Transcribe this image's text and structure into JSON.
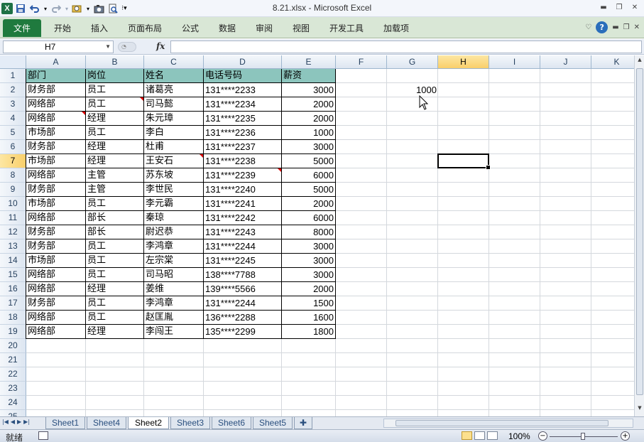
{
  "app": {
    "title": "8.21.xlsx - Microsoft Excel",
    "logo_letter": "X"
  },
  "ribbon": {
    "file_tab": "文件",
    "tabs": [
      "开始",
      "插入",
      "页面布局",
      "公式",
      "数据",
      "审阅",
      "视图",
      "开发工具",
      "加载项"
    ],
    "help_symbol": "?"
  },
  "formula_bar": {
    "name_box": "H7",
    "fx_symbol": "fx",
    "formula": ""
  },
  "columns": [
    "A",
    "B",
    "C",
    "D",
    "E",
    "F",
    "G",
    "H",
    "I",
    "J",
    "K"
  ],
  "selected_column": "H",
  "selected_row": "7",
  "rows": [
    "1",
    "2",
    "3",
    "4",
    "5",
    "6",
    "7",
    "8",
    "9",
    "10",
    "11",
    "12",
    "13",
    "14",
    "15",
    "16",
    "17",
    "18",
    "19",
    "20",
    "21",
    "22",
    "23",
    "24",
    "25"
  ],
  "table": {
    "headers": [
      "部门",
      "岗位",
      "姓名",
      "电话号码",
      "薪资"
    ],
    "records": [
      [
        "财务部",
        "员工",
        "诸葛亮",
        "131****2233",
        "3000"
      ],
      [
        "网络部",
        "员工",
        "司马懿",
        "131****2234",
        "2000"
      ],
      [
        "网络部",
        "经理",
        "朱元璋",
        "131****2235",
        "2000"
      ],
      [
        "市场部",
        "员工",
        "李白",
        "131****2236",
        "1000"
      ],
      [
        "财务部",
        "经理",
        "杜甫",
        "131****2237",
        "3000"
      ],
      [
        "市场部",
        "经理",
        "王安石",
        "131****2238",
        "5000"
      ],
      [
        "网络部",
        "主管",
        "苏东坡",
        "131****2239",
        "6000"
      ],
      [
        "财务部",
        "主管",
        "李世民",
        "131****2240",
        "5000"
      ],
      [
        "市场部",
        "员工",
        "李元霸",
        "131****2241",
        "2000"
      ],
      [
        "网络部",
        "部长",
        "秦琼",
        "131****2242",
        "6000"
      ],
      [
        "财务部",
        "部长",
        "尉迟恭",
        "131****2243",
        "8000"
      ],
      [
        "财务部",
        "员工",
        "李鸿章",
        "131****2244",
        "3000"
      ],
      [
        "市场部",
        "员工",
        "左宗棠",
        "131****2245",
        "3000"
      ],
      [
        "网络部",
        "员工",
        "司马昭",
        "138****7788",
        "3000"
      ],
      [
        "网络部",
        "经理",
        "姜维",
        "139****5566",
        "2000"
      ],
      [
        "财务部",
        "员工",
        "李鸿章",
        "131****2244",
        "1500"
      ],
      [
        "网络部",
        "员工",
        "赵匡胤",
        "136****2288",
        "1600"
      ],
      [
        "网络部",
        "经理",
        "李闯王",
        "135****2299",
        "1800"
      ]
    ]
  },
  "extra_cells": {
    "G2": "1000"
  },
  "sheets": {
    "tabs": [
      "Sheet1",
      "Sheet4",
      "Sheet2",
      "Sheet3",
      "Sheet6",
      "Sheet5"
    ],
    "active": "Sheet2"
  },
  "status": {
    "ready_text": "就绪",
    "zoom": "100%"
  },
  "colors": {
    "header_fill": "#8cc5bd",
    "ribbon_bg": "#d9e7d6",
    "file_tab": "#1f7a3e",
    "selected_header": "#f9cf6a"
  }
}
